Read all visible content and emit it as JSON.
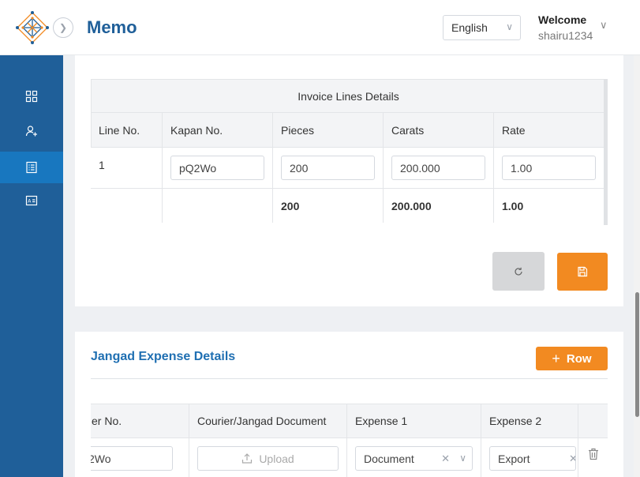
{
  "header": {
    "app_title": "Memo",
    "language": "English",
    "welcome": "Welcome",
    "username": "shairu1234"
  },
  "sidebar": {
    "items": [
      {
        "icon": "dashboard-grid-icon",
        "active": false
      },
      {
        "icon": "user-add-icon",
        "active": false
      },
      {
        "icon": "list-document-icon",
        "active": true
      },
      {
        "icon": "id-card-icon",
        "active": false
      }
    ]
  },
  "invoice_lines": {
    "caption": "Invoice Lines Details",
    "columns": [
      "Line No.",
      "Kapan No.",
      "Pieces",
      "Carats",
      "Rate"
    ],
    "row": {
      "line_no": "1",
      "kapan_no": "pQ2Wo",
      "pieces": "200",
      "carats": "200.000",
      "rate": "1.00"
    },
    "totals": {
      "pieces": "200",
      "carats": "200.000",
      "rate": "1.00"
    }
  },
  "jangad_expense": {
    "title": "Jangad Expense Details",
    "add_row_label": "Row",
    "columns": [
      "er No.",
      "Courier/Jangad Document",
      "Expense 1",
      "Expense 2"
    ],
    "row": {
      "no_value": "2Wo",
      "upload_label": "Upload",
      "expense1": "Document",
      "expense2": "Export"
    }
  },
  "colors": {
    "brand_blue": "#1f5f99",
    "sidebar_active": "#1877bf",
    "accent_orange": "#f28a21",
    "link_blue": "#1f6fb2"
  }
}
